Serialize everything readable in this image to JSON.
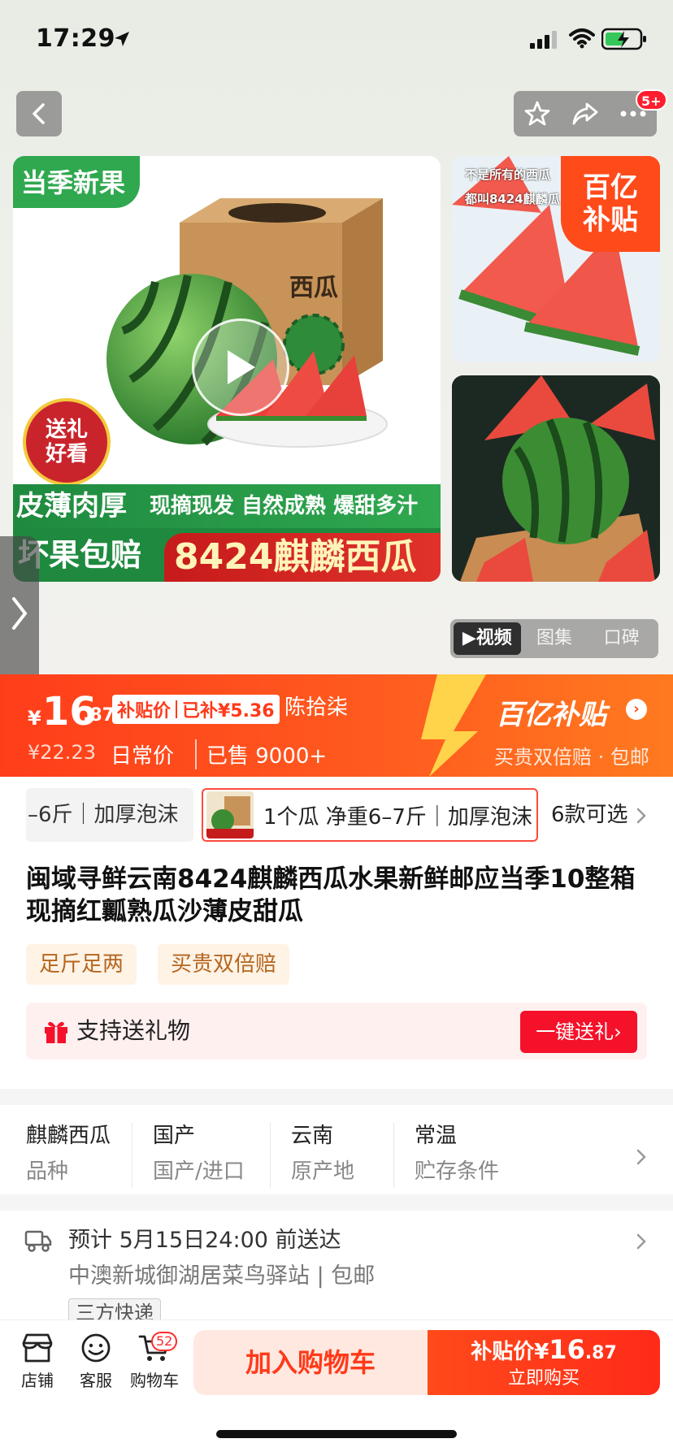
{
  "status_bar": {
    "time": "17:29"
  },
  "header": {
    "notification_badge": "5+"
  },
  "hero": {
    "main_image": {
      "tag_top": "当季新果",
      "box_label": "西瓜",
      "seal_line1": "送礼",
      "seal_line2": "好看",
      "band1_left": "皮薄肉厚",
      "band1_right": "现摘现发 自然成熟 爆甜多汁",
      "band2_left": "坏果包赔",
      "band2_right": "8424麒麟西瓜"
    },
    "thumb1": {
      "text_line1": "不是所有的西瓜",
      "text_line2": "都叫8424麒麟瓜",
      "badge_line1": "百亿",
      "badge_line2": "补贴"
    },
    "media_tabs": [
      {
        "label": "▶视频",
        "active": true
      },
      {
        "label": "图集",
        "active": false
      },
      {
        "label": "口碑",
        "active": false
      }
    ]
  },
  "price_banner": {
    "currency": "¥",
    "price_int": "16",
    "price_dec": ".87",
    "subsidy_label": "补贴价",
    "subsidy_amount": "已补¥5.36",
    "seller": "陈拾柒",
    "old_price": "¥22.23",
    "daily_label": "日常价",
    "sold": "已售 9000+",
    "program_name": "百亿补贴",
    "program_arrow": "›",
    "program_sub": "买贵双倍赔 · 包邮"
  },
  "sku": {
    "prev_label": "–6斤｜加厚泡沫",
    "current_label": "1个瓜 净重6–7斤｜加厚泡沫",
    "count_label": "6款可选"
  },
  "product": {
    "title": "闽域寻鲜云南8424麒麟西瓜水果新鲜邮应当季10整箱现摘红瓤熟瓜沙薄皮甜瓜",
    "chips": [
      "足斤足两",
      "买贵双倍赔"
    ]
  },
  "gift": {
    "text": "支持送礼物",
    "button": "一键送礼›"
  },
  "attributes": [
    {
      "value": "麒麟西瓜",
      "key": "品种"
    },
    {
      "value": "国产",
      "key": "国产/进口"
    },
    {
      "value": "云南",
      "key": "原产地"
    },
    {
      "value": "常温",
      "key": "贮存条件"
    }
  ],
  "delivery": {
    "eta": "预计 5月15日24:00 前送达",
    "address": "中澳新城御湖居菜鸟驿站 | 包邮",
    "tag": "三方快递"
  },
  "bottom_bar": {
    "nav": [
      {
        "label": "店铺"
      },
      {
        "label": "客服"
      },
      {
        "label": "购物车"
      }
    ],
    "cart_count": "52",
    "add_to_cart": "加入购物车",
    "buy_price_label": "补贴价",
    "buy_currency": "¥",
    "buy_price_int": "16",
    "buy_price_dec": ".87",
    "buy_now": "立即购买"
  },
  "colors": {
    "accent": "#ff4a1a",
    "brand_red": "#f5112a",
    "green": "#2fa84f"
  }
}
